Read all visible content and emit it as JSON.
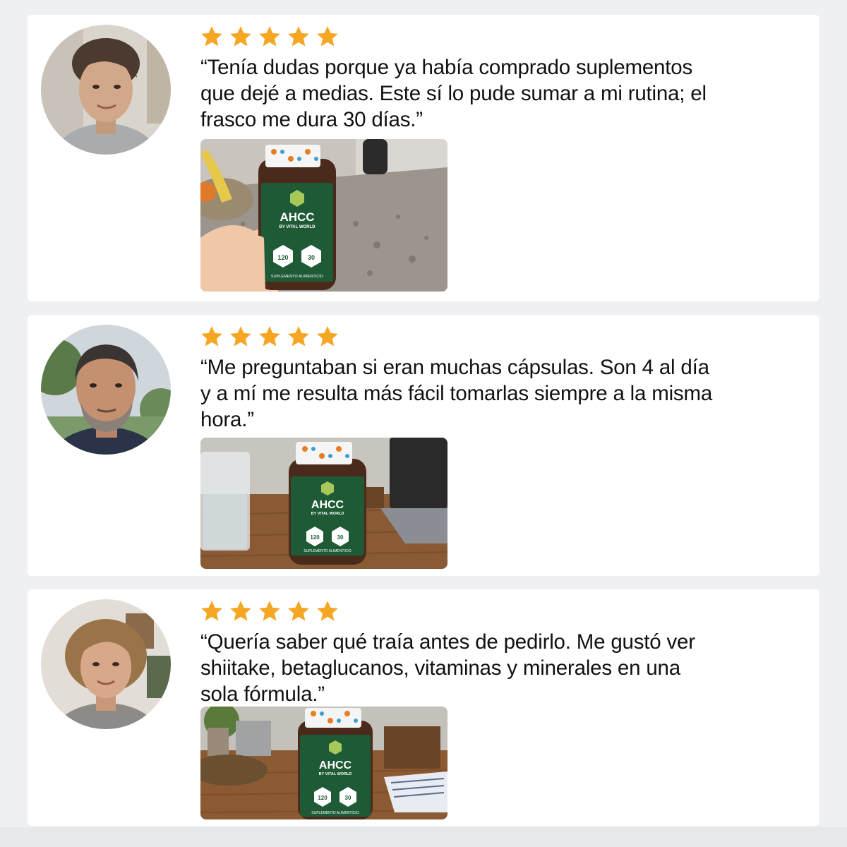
{
  "reviews": [
    {
      "rating": 5,
      "quote": "“Tenía dudas porque ya había comprado suplementos que dejé a medias. Este sí lo pude sumar a mi rutina; el frasco me dura 30 días.”",
      "avatar_icon": "woman-avatar-icon",
      "photo": {
        "brand": "AHCC",
        "sub": "BY VITAL WORLD",
        "count": "120",
        "servings": "30",
        "footer": "SUPLEMENTO ALIMENTICIO"
      }
    },
    {
      "rating": 5,
      "quote": "“Me preguntaban si eran muchas cápsulas. Son 4 al día y a mí me resulta más fácil tomarlas siempre a la misma hora.”",
      "avatar_icon": "man-avatar-icon",
      "photo": {
        "brand": "AHCC",
        "sub": "BY VITAL WORLD",
        "count": "120",
        "servings": "30",
        "footer": "SUPLEMENTO ALIMENTICIO"
      }
    },
    {
      "rating": 5,
      "quote": "“Quería saber qué traía antes de pedirlo. Me gustó ver shiitake, betaglucanos, vitaminas y minerales en una sola fórmula.”",
      "avatar_icon": "woman-avatar-icon",
      "photo": {
        "brand": "AHCC",
        "sub": "BY VITAL WORLD",
        "count": "120",
        "servings": "30",
        "footer": "SUPLEMENTO ALIMENTICIO"
      }
    }
  ],
  "colors": {
    "star": "#f5a623",
    "bottle_label": "#1f5a37",
    "text": "#111111",
    "background": "#eef0f3"
  }
}
